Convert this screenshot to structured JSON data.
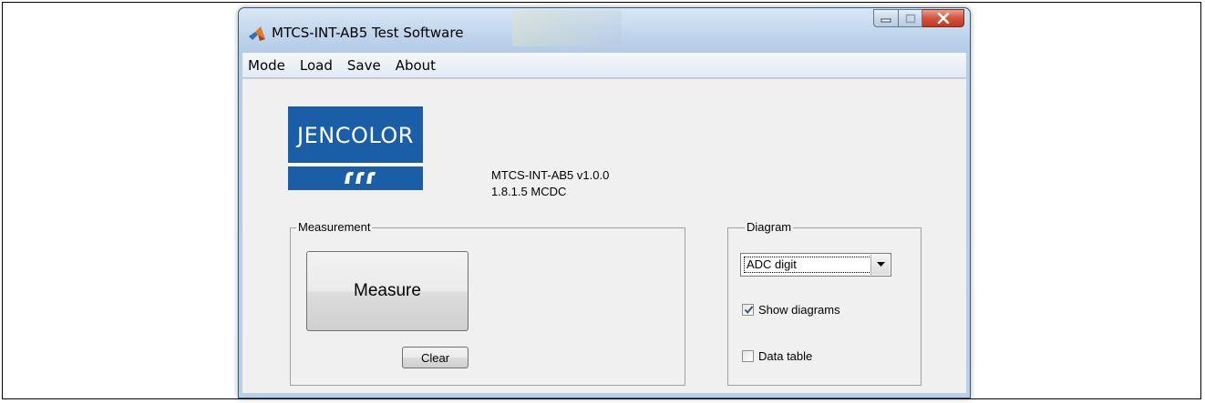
{
  "window": {
    "title": "MTCS-INT-AB5 Test Software"
  },
  "menu": {
    "items": [
      "Mode",
      "Load",
      "Save",
      "About"
    ]
  },
  "logo": {
    "text": "JENCOLOR",
    "color": "#1a5ea8"
  },
  "version": {
    "line1": "MTCS-INT-AB5 v1.0.0",
    "line2": "1.8.1.5 MCDC"
  },
  "measurement": {
    "group_label": "Measurement",
    "measure_label": "Measure",
    "clear_label": "Clear"
  },
  "diagram": {
    "group_label": "Diagram",
    "select_value": "ADC digit",
    "show_diagrams": {
      "label": "Show diagrams",
      "checked": true
    },
    "data_table": {
      "label": "Data table",
      "checked": false
    }
  },
  "icons": [
    "matlab-icon",
    "minimize-icon",
    "maximize-icon",
    "close-icon",
    "dropdown-arrow-icon",
    "checkmark-icon"
  ]
}
